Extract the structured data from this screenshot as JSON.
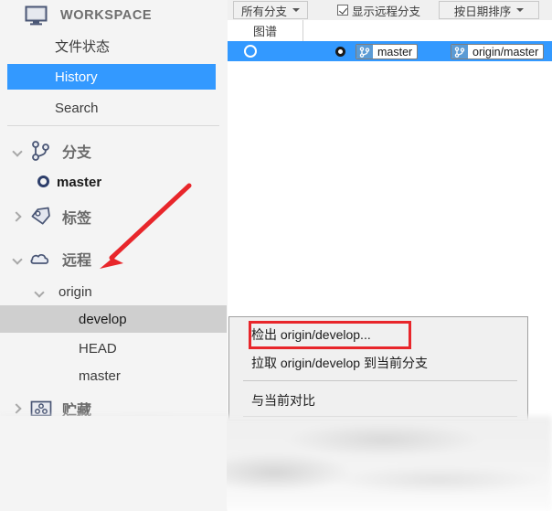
{
  "workspace": {
    "icon": "monitor-icon",
    "title": "WORKSPACE",
    "nav": [
      {
        "label": "文件状态",
        "selected": false
      },
      {
        "label": "History",
        "selected": true
      },
      {
        "label": "Search",
        "selected": false
      }
    ]
  },
  "sidebar": {
    "groups": [
      {
        "label": "分支",
        "icon": "branch-icon",
        "expanded": true,
        "children": [
          {
            "label": "master",
            "icon": "commit-dot-icon",
            "current": true
          }
        ]
      },
      {
        "label": "标签",
        "icon": "tag-icon",
        "expanded": false,
        "children": []
      },
      {
        "label": "远程",
        "icon": "cloud-icon",
        "expanded": true,
        "children": [
          {
            "label": "origin",
            "expanded": true
          },
          {
            "label": "develop",
            "highlighted": true
          },
          {
            "label": "HEAD",
            "highlighted": false
          },
          {
            "label": "master",
            "highlighted": false
          }
        ]
      },
      {
        "label": "贮藏",
        "icon": "stash-icon",
        "expanded": false,
        "children": []
      }
    ]
  },
  "toolbar": {
    "branch_filter": "所有分支",
    "show_remote_branches": "显示远程分支",
    "show_remote_checked": true,
    "sort_order": "按日期排序"
  },
  "history": {
    "columns": [
      "图谱"
    ],
    "rows": [
      {
        "selected": true,
        "refs": [
          {
            "name": "master",
            "icon": "branch-icon"
          },
          {
            "name": "origin/master",
            "icon": "branch-icon"
          }
        ]
      }
    ]
  },
  "context_menu": {
    "items": [
      {
        "label": "检出 origin/develop...",
        "highlighted": true
      },
      {
        "label": "拉取 origin/develop 到当前分支",
        "highlighted": false
      },
      {
        "separator_after": true
      },
      {
        "label": "与当前对比",
        "highlighted": false
      }
    ]
  },
  "annotations": {
    "arrow_color": "#e8262b",
    "highlight_box_color": "#e8262b",
    "arrow_points_to": "远程"
  },
  "colors": {
    "selection_blue": "#3399ff",
    "row_highlight_gray": "#cfcfcf",
    "sidebar_bg": "#f4f4f4",
    "panel_bg": "#ffffff",
    "annotation_red": "#e8262b"
  }
}
